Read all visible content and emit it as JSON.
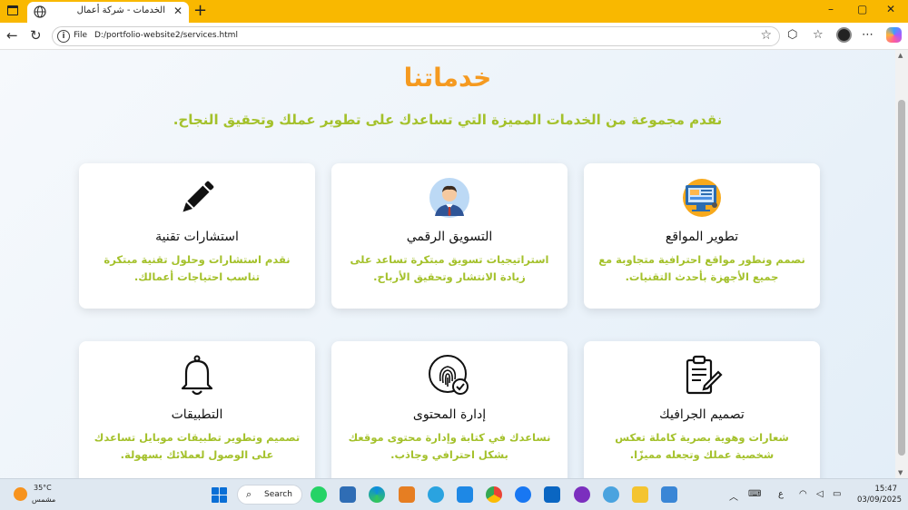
{
  "browser": {
    "tab_title": "الخدمات - شركة أعمال",
    "new_tab": "+",
    "protocol": "File",
    "url": "D:/portfolio-website2/services.html",
    "controls": {
      "minimize": "–",
      "maximize": "▢",
      "close": "✕"
    }
  },
  "page": {
    "title": "خدماتنا",
    "subtitle": "نقدم مجموعة من الخدمات المميزة التي تساعدك على تطوير عملك وتحقيق النجاح.",
    "services": [
      {
        "icon": "web-development-icon",
        "title": "تطوير المواقع",
        "description": "نصمم ونطور مواقع احترافية متجاوبة مع جميع الأجهزة بأحدث التقنيات."
      },
      {
        "icon": "marketer-avatar-icon",
        "title": "التسويق الرقمي",
        "description": "استراتيجيات تسويق مبتكرة تساعد على زيادة الانتشار وتحقيق الأرباح."
      },
      {
        "icon": "pencil-icon",
        "title": "استشارات تقنية",
        "description": "نقدم استشارات وحلول تقنية مبتكرة تناسب احتياجات أعمالك."
      },
      {
        "icon": "clipboard-edit-icon",
        "title": "تصميم الجرافيك",
        "description": "شعارات وهوية بصرية كاملة تعكس شخصية عملك وتجعله مميزًا."
      },
      {
        "icon": "fingerprint-check-icon",
        "title": "إدارة المحتوى",
        "description": "نساعدك في كتابة وإدارة محتوى موقعك بشكل احترافي وجاذب."
      },
      {
        "icon": "bell-icon",
        "title": "التطبيقات",
        "description": "تصميم وتطوير تطبيقات موبايل تساعدك على الوصول لعملائك بسهولة."
      }
    ]
  },
  "taskbar": {
    "weather_temp": "35°C",
    "weather_desc": "مشمس",
    "search_label": "Search",
    "lang": "ع",
    "time": "15:47",
    "date": "03/09/2025"
  },
  "colors": {
    "title": "#f59a20",
    "accent": "#a4c12b",
    "tabbar": "#f9b800"
  }
}
